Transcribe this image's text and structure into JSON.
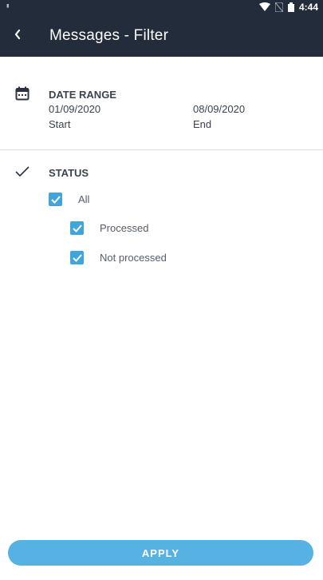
{
  "status_bar": {
    "time": "4:44",
    "icons": [
      "signal-icon",
      "wifi-icon",
      "no-sim-icon",
      "battery-icon"
    ]
  },
  "header": {
    "title": "Messages - Filter",
    "back_icon": "chevron-left-icon"
  },
  "date_range": {
    "icon": "calendar-icon",
    "heading": "DATE RANGE",
    "start_value": "01/09/2020",
    "start_label": "Start",
    "end_value": "08/09/2020",
    "end_label": "End"
  },
  "status": {
    "icon": "checkmark-icon",
    "heading": "STATUS",
    "options": [
      {
        "label": "All",
        "checked": true
      },
      {
        "label": "Processed",
        "checked": true
      },
      {
        "label": "Not processed",
        "checked": true
      }
    ]
  },
  "apply_button": {
    "label": "APPLY"
  },
  "colors": {
    "header_bg": "#232c3a",
    "accent": "#3fa6dc",
    "apply_bg": "#55b2e3"
  }
}
